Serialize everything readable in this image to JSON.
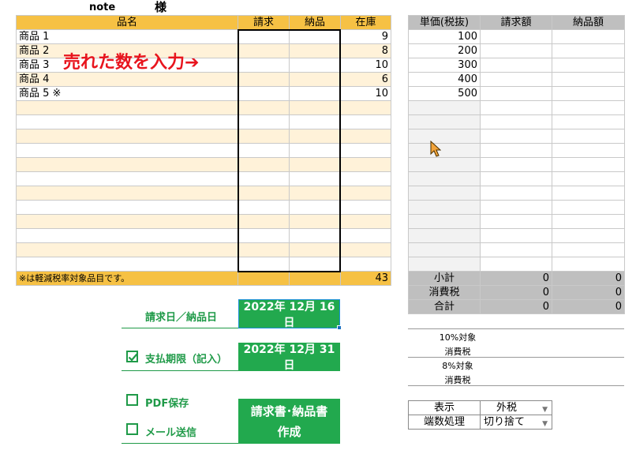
{
  "header": {
    "customer": "note",
    "honorific": "様"
  },
  "left_table": {
    "headers": [
      "品名",
      "請求",
      "納品",
      "在庫"
    ],
    "rows": [
      {
        "name": "商品 1",
        "stock": "9"
      },
      {
        "name": "商品 2",
        "stock": "8"
      },
      {
        "name": "商品 3",
        "stock": "10"
      },
      {
        "name": "商品 4",
        "stock": "6"
      },
      {
        "name": "商品 5 ※",
        "stock": "10"
      }
    ],
    "empty_rows": 12,
    "footer_note": "※は軽減税率対象品目です。",
    "footer_stock_total": "43"
  },
  "annotation": "売れた数を入力➔",
  "right_table": {
    "headers": [
      "単価(税抜)",
      "請求額",
      "納品額"
    ],
    "prices": [
      "100",
      "200",
      "300",
      "400",
      "500"
    ],
    "summary": [
      {
        "label": "小計",
        "invoice": "0",
        "delivery": "0"
      },
      {
        "label": "消費税",
        "invoice": "0",
        "delivery": "0"
      },
      {
        "label": "合計",
        "invoice": "0",
        "delivery": "0"
      }
    ]
  },
  "tax_breakdown": {
    "rate10_label": "10%対象",
    "rate10_tax": "消費税",
    "rate8_label": "8%対象",
    "rate8_tax": "消費税"
  },
  "settings": {
    "display_label": "表示",
    "display_value": "外税",
    "rounding_label": "端数処理",
    "rounding_value": "切り捨て"
  },
  "controls": {
    "issue_date_label": "請求日／納品日",
    "issue_date_value": "2022年 12月 16日",
    "due_date_label": "支払期限（記入）",
    "due_date_checked": true,
    "due_date_value": "2022年 12月 31日",
    "pdf_save_label": "PDF保存",
    "pdf_save_checked": false,
    "mail_send_label": "メール送信",
    "mail_send_checked": false,
    "create_button_line1": "請求書･納品書",
    "create_button_line2": "作成"
  },
  "colors": {
    "header_yellow": "#f6c144",
    "row_cream": "#fff2d9",
    "accent_green": "#22a94e",
    "annotation_red": "#e8141d",
    "summary_gray": "#bfbfbf"
  }
}
